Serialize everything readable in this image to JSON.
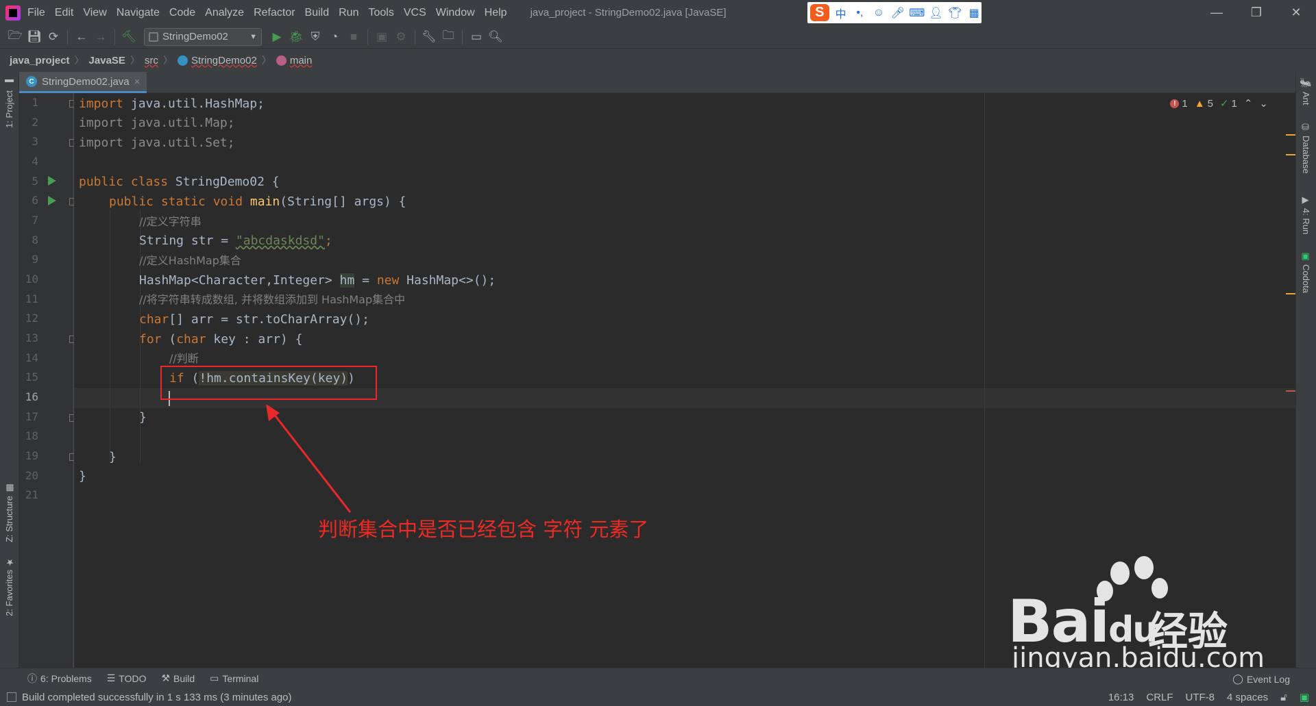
{
  "menubar": {
    "items": [
      "File",
      "Edit",
      "View",
      "Navigate",
      "Code",
      "Analyze",
      "Refactor",
      "Build",
      "Run",
      "Tools",
      "VCS",
      "Window",
      "Help"
    ],
    "window_title": "java_project - StringDemo02.java [JavaSE]",
    "ime": {
      "logo": "S",
      "mode": "中",
      "punct": "•,"
    }
  },
  "toolbar": {
    "run_config": "StringDemo02"
  },
  "breadcrumb": {
    "items": [
      "java_project",
      "JavaSE",
      "src",
      "StringDemo02",
      "main"
    ]
  },
  "editor_tab": {
    "filename": "StringDemo02.java",
    "close": "×"
  },
  "left_strip": {
    "project": "1: Project",
    "structure": "Z: Structure",
    "favorites": "2: Favorites"
  },
  "right_strip": {
    "ant": "Ant",
    "database": "Database",
    "run": "4: Run",
    "codota": "Codota"
  },
  "inspections": {
    "errors": "1",
    "warnings": "5",
    "weak": "1"
  },
  "code": {
    "line_numbers": [
      "1",
      "2",
      "3",
      "4",
      "5",
      "6",
      "7",
      "8",
      "9",
      "10",
      "11",
      "12",
      "13",
      "14",
      "15",
      "16",
      "17",
      "18",
      "19",
      "20",
      "21"
    ],
    "l1_kw": "import",
    "l1_rest": " java.util.HashMap;",
    "l2": "import java.util.Map;",
    "l3": "import java.util.Set;",
    "l5_kw": "public class",
    "l5_rest": " StringDemo02 {",
    "l6_kw": "public static void",
    "l6_fn": "main",
    "l6_rest": "(String[] args) {",
    "l7": "//定义字符串",
    "l8_a": "String str = ",
    "l8_str": "\"abcdaskdsd\"",
    "l8_b": ";",
    "l9": "//定义HashMap集合",
    "l10_a": "HashMap<Character,Integer> ",
    "l10_var": "hm",
    "l10_b": " = ",
    "l10_kw": "new",
    "l10_c": " HashMap<>();",
    "l11": "//将字符串转成数组, 并将数组添加到 HashMap集合中",
    "l12_kw": "char",
    "l12_rest": "[] arr = str.toCharArray();",
    "l13_kw": "for",
    "l13_a": " (",
    "l13_kw2": "char",
    "l13_b": " key : arr) {",
    "l14": "//判断",
    "l15_kw": "if",
    "l15_a": " (",
    "l15_expr": "!hm.containsKey(key)",
    "l15_b": ")",
    "l17": "}",
    "l19": "}",
    "l20": "}"
  },
  "annotation": {
    "text": "判断集合中是否已经包含 字符 元素了",
    "color": "#ee2a24"
  },
  "watermark": {
    "brand": "Bai",
    "brand2": "du",
    "cn": "经验",
    "url": "jingyan.baidu.com"
  },
  "bottom_tabs": [
    {
      "label": "6: Problems"
    },
    {
      "label": "TODO"
    },
    {
      "label": "Build"
    },
    {
      "label": "Terminal"
    }
  ],
  "event_log": "Event Log",
  "status": {
    "message": "Build completed successfully in 1 s 133 ms (3 minutes ago)",
    "position": "16:13",
    "line_sep": "CRLF",
    "encoding": "UTF-8",
    "indent": "4 spaces"
  },
  "colors": {
    "accent": "#4a88c7",
    "keyword": "#cc7832",
    "string": "#6a8759",
    "comment": "#808080",
    "run": "#499c54"
  }
}
